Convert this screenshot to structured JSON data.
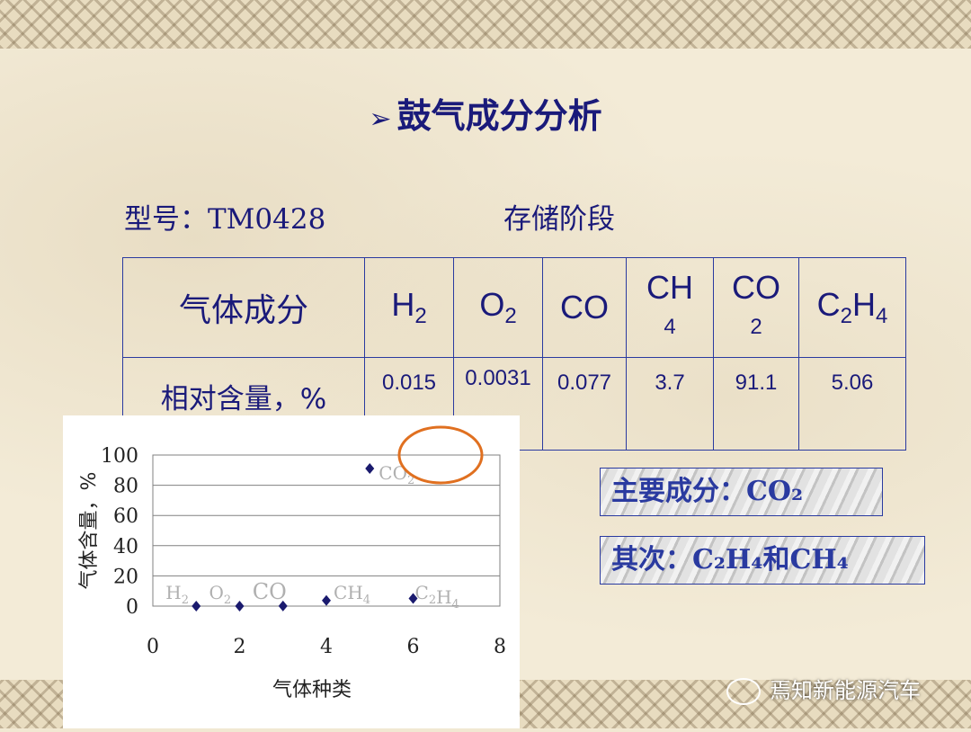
{
  "title": "鼓气成分分析",
  "title_marker": "➢",
  "model_label": "型号：TM0428",
  "stage_label": "存储阶段",
  "table": {
    "header_label": "气体成分",
    "value_label": "相对含量，%",
    "gases": [
      {
        "base": "H",
        "sub": "2",
        "value": "0.015"
      },
      {
        "base": "O",
        "sub": "2",
        "value": "0.0031"
      },
      {
        "base": "CO",
        "sub": "",
        "value": "0.077"
      },
      {
        "base": "CH",
        "sub": "4",
        "value": "3.7"
      },
      {
        "base": "CO",
        "sub": "2",
        "value": "91.1"
      },
      {
        "base": "C2H4",
        "sub": "",
        "value": "5.06"
      }
    ]
  },
  "callouts": {
    "main": "主要成分：CO₂",
    "secondary": "其次：C₂H₄和CH₄"
  },
  "watermark": "焉知新能源汽车",
  "colors": {
    "text": "#1a1a7a",
    "marker": "#1a1a6e",
    "highlight_circle": "#e07020",
    "annotation_gray": "#b0b0b0"
  },
  "chart_data": {
    "type": "scatter",
    "xlabel": "气体种类",
    "ylabel": "气体含量，%",
    "xlim": [
      0,
      8
    ],
    "ylim": [
      0,
      100
    ],
    "xticks": [
      0,
      2,
      4,
      6,
      8
    ],
    "yticks": [
      0,
      20,
      40,
      60,
      80,
      100
    ],
    "grid": true,
    "points": [
      {
        "x": 1,
        "y": 0.015,
        "label": "H2"
      },
      {
        "x": 2,
        "y": 0.0031,
        "label": "O2"
      },
      {
        "x": 3,
        "y": 0.077,
        "label": "CO"
      },
      {
        "x": 4,
        "y": 3.7,
        "label": "CH4"
      },
      {
        "x": 5,
        "y": 91.1,
        "label": "CO2"
      },
      {
        "x": 6,
        "y": 5.06,
        "label": "C2H4"
      }
    ]
  }
}
